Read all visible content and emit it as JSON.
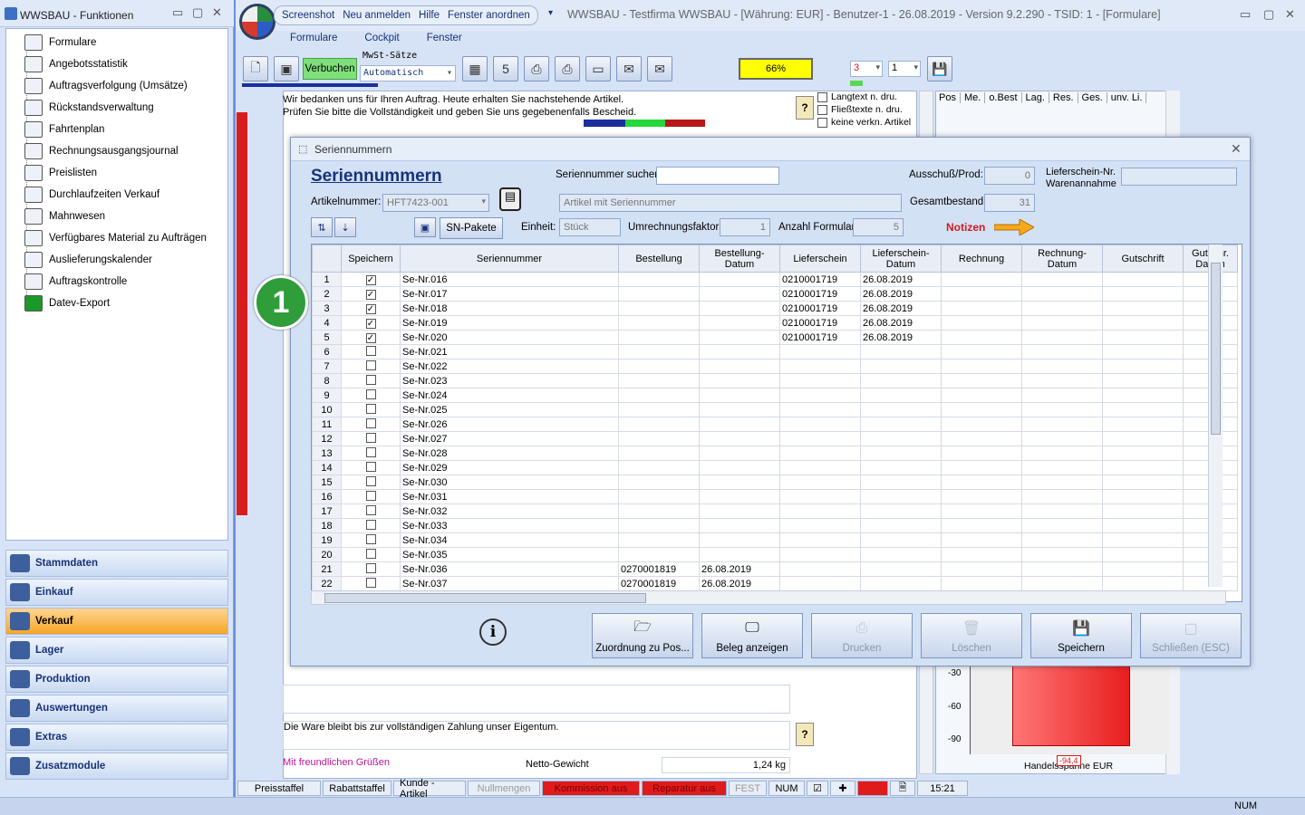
{
  "left_window": {
    "title": "WWSBAU - Funktionen",
    "tree_items": [
      "Formulare",
      "Angebotsstatistik",
      "Auftragsverfolgung (Umsätze)",
      "Rückstandsverwaltung",
      "Fahrtenplan",
      "Rechnungsausgangsjournal",
      "Preislisten",
      "Durchlaufzeiten Verkauf",
      "Mahnwesen",
      "Verfügbares Material zu Aufträgen",
      "Auslieferungskalender",
      "Auftragskontrolle",
      "Datev-Export"
    ],
    "nav": [
      "Stammdaten",
      "Einkauf",
      "Verkauf",
      "Lager",
      "Produktion",
      "Auswertungen",
      "Extras",
      "Zusatzmodule"
    ],
    "active_nav": "Verkauf"
  },
  "main": {
    "quick_access": [
      "Screenshot",
      "Neu anmelden",
      "Hilfe",
      "Fenster anordnen"
    ],
    "title": "WWSBAU - Testfirma WWSBAU - [Währung: EUR] - Benutzer-1 - 26.08.2019 - Version 9.2.290 - TSID: 1  - [Formulare]",
    "menu": [
      "Formulare",
      "Cockpit",
      "Fenster"
    ],
    "toolbar": {
      "verbuchen": "Verbuchen",
      "mwst_label": "MwSt-Sätze",
      "mwst_value": "Automatisch",
      "zoom": "66%",
      "copies": "3",
      "page": "1"
    },
    "doc": {
      "line1": "Wir bedanken uns für Ihren Auftrag. Heute erhalten Sie nachstehende Artikel.",
      "line2": "Prüfen Sie bitte die Vollständigkeit und geben Sie uns gegebenenfalls Bescheid.",
      "opt1": "Langtext n. dru.",
      "opt2": "Fließtexte n. dru.",
      "opt3": "keine verkn. Artikel",
      "footer1": "Die Ware bleibt bis zur vollständigen Zahlung unser Eigentum.",
      "footer2": "Mit freundlichen Grüßen",
      "netto_label": "Netto-Gewicht",
      "netto_value": "1,24 kg"
    },
    "right_cols": [
      "Pos",
      "Me.",
      "o.Best",
      "Lag.",
      "Res.",
      "Ges.",
      "unv. Li."
    ],
    "chart_yticks": [
      "-30",
      "-60",
      "-90"
    ],
    "chart_label": "Handelsspanne EUR",
    "chart_value": "-94,4",
    "status": [
      "Preisstaffel",
      "Rabattstaffel",
      "Kunde - Artikel",
      "Nullmengen",
      "Kommission aus",
      "Reparatur aus",
      "FEST",
      "NUM",
      "15:21"
    ],
    "bottom_num": "NUM"
  },
  "dialog": {
    "title": "Seriennummern",
    "heading": "Seriennummern",
    "search_label": "Seriennummer suchen:",
    "search_value": "",
    "ausschuss_label": "Ausschuß/Prod:",
    "ausschuss_value": "0",
    "lieferschein_label": "Lieferschein-Nr.",
    "warenannahme_label": "Warenannahme",
    "artikel_label": "Artikelnummer:",
    "artikel_value": "HFT7423-001",
    "artikel_desc": "Artikel mit Seriennummer",
    "gesamt_label": "Gesamtbestand:",
    "gesamt_value": "31",
    "snpakete": "SN-Pakete",
    "einheit_label": "Einheit:",
    "einheit_value": "Stück",
    "umrechnung_label": "Umrechnungsfaktor:",
    "umrechnung_value": "1",
    "anzahl_label": "Anzahl Formular:",
    "anzahl_value": "5",
    "notizen": "Notizen",
    "columns": [
      "Speichern",
      "Seriennummer",
      "Bestellung",
      "Bestellung-Datum",
      "Lieferschein",
      "Lieferschein-Datum",
      "Rechnung",
      "Rechnung-Datum",
      "Gutschrift",
      "Gutschr. Datum"
    ],
    "rows": [
      {
        "n": "1",
        "chk": true,
        "sn": "Se-Nr.016",
        "best": "",
        "bdat": "",
        "ls": "0210001719",
        "lsdat": "26.08.2019"
      },
      {
        "n": "2",
        "chk": true,
        "sn": "Se-Nr.017",
        "best": "",
        "bdat": "",
        "ls": "0210001719",
        "lsdat": "26.08.2019"
      },
      {
        "n": "3",
        "chk": true,
        "sn": "Se-Nr.018",
        "best": "",
        "bdat": "",
        "ls": "0210001719",
        "lsdat": "26.08.2019"
      },
      {
        "n": "4",
        "chk": true,
        "sn": "Se-Nr.019",
        "best": "",
        "bdat": "",
        "ls": "0210001719",
        "lsdat": "26.08.2019"
      },
      {
        "n": "5",
        "chk": true,
        "sn": "Se-Nr.020",
        "best": "",
        "bdat": "",
        "ls": "0210001719",
        "lsdat": "26.08.2019"
      },
      {
        "n": "6",
        "chk": false,
        "sn": "Se-Nr.021",
        "best": "",
        "bdat": "",
        "ls": "",
        "lsdat": ""
      },
      {
        "n": "7",
        "chk": false,
        "sn": "Se-Nr.022",
        "best": "",
        "bdat": "",
        "ls": "",
        "lsdat": ""
      },
      {
        "n": "8",
        "chk": false,
        "sn": "Se-Nr.023",
        "best": "",
        "bdat": "",
        "ls": "",
        "lsdat": ""
      },
      {
        "n": "9",
        "chk": false,
        "sn": "Se-Nr.024",
        "best": "",
        "bdat": "",
        "ls": "",
        "lsdat": ""
      },
      {
        "n": "10",
        "chk": false,
        "sn": "Se-Nr.025",
        "best": "",
        "bdat": "",
        "ls": "",
        "lsdat": ""
      },
      {
        "n": "11",
        "chk": false,
        "sn": "Se-Nr.026",
        "best": "",
        "bdat": "",
        "ls": "",
        "lsdat": ""
      },
      {
        "n": "12",
        "chk": false,
        "sn": "Se-Nr.027",
        "best": "",
        "bdat": "",
        "ls": "",
        "lsdat": ""
      },
      {
        "n": "13",
        "chk": false,
        "sn": "Se-Nr.028",
        "best": "",
        "bdat": "",
        "ls": "",
        "lsdat": ""
      },
      {
        "n": "14",
        "chk": false,
        "sn": "Se-Nr.029",
        "best": "",
        "bdat": "",
        "ls": "",
        "lsdat": ""
      },
      {
        "n": "15",
        "chk": false,
        "sn": "Se-Nr.030",
        "best": "",
        "bdat": "",
        "ls": "",
        "lsdat": ""
      },
      {
        "n": "16",
        "chk": false,
        "sn": "Se-Nr.031",
        "best": "",
        "bdat": "",
        "ls": "",
        "lsdat": ""
      },
      {
        "n": "17",
        "chk": false,
        "sn": "Se-Nr.032",
        "best": "",
        "bdat": "",
        "ls": "",
        "lsdat": ""
      },
      {
        "n": "18",
        "chk": false,
        "sn": "Se-Nr.033",
        "best": "",
        "bdat": "",
        "ls": "",
        "lsdat": ""
      },
      {
        "n": "19",
        "chk": false,
        "sn": "Se-Nr.034",
        "best": "",
        "bdat": "",
        "ls": "",
        "lsdat": ""
      },
      {
        "n": "20",
        "chk": false,
        "sn": "Se-Nr.035",
        "best": "",
        "bdat": "",
        "ls": "",
        "lsdat": ""
      },
      {
        "n": "21",
        "chk": false,
        "sn": "Se-Nr.036",
        "best": "0270001819",
        "bdat": "26.08.2019",
        "ls": "",
        "lsdat": ""
      },
      {
        "n": "22",
        "chk": false,
        "sn": "Se-Nr.037",
        "best": "0270001819",
        "bdat": "26.08.2019",
        "ls": "",
        "lsdat": ""
      }
    ],
    "buttons": [
      {
        "label": "Zuordnung zu Pos...",
        "enabled": true,
        "icon": "folder-icon"
      },
      {
        "label": "Beleg anzeigen",
        "enabled": true,
        "icon": "monitor-icon"
      },
      {
        "label": "Drucken",
        "enabled": false,
        "icon": "printer-icon"
      },
      {
        "label": "Löschen",
        "enabled": false,
        "icon": "trash-icon"
      },
      {
        "label": "Speichern",
        "enabled": true,
        "icon": "save-icon"
      },
      {
        "label": "Schließen (ESC)",
        "enabled": false,
        "icon": "close-icon"
      }
    ]
  },
  "badge": "1"
}
